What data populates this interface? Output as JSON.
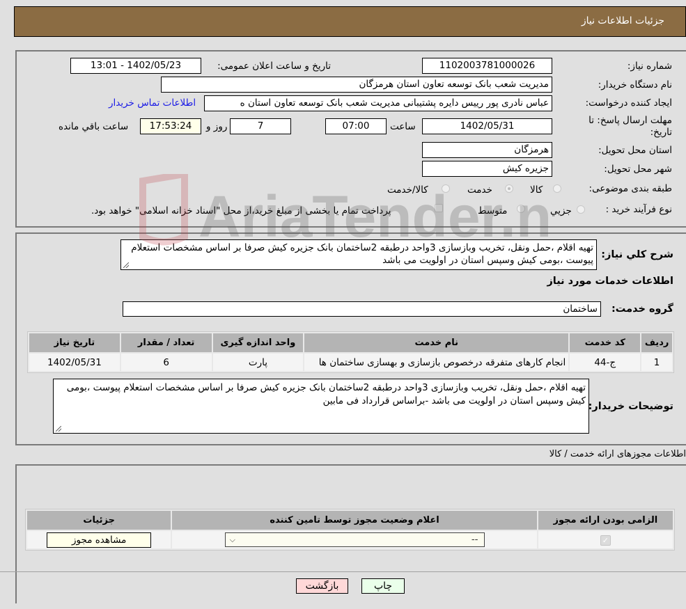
{
  "header": {
    "title": "جزئیات اطلاعات نیاز"
  },
  "details": {
    "need_number_label": "شماره نیاز:",
    "need_number": "1102003781000026",
    "announce_label": "تاریخ و ساعت اعلان عمومی:",
    "announce_value": "1402/05/23 - 13:01",
    "buyer_org_label": "نام دستگاه خریدار:",
    "buyer_org": "مدیریت شعب بانک توسعه تعاون استان هرمزگان",
    "creator_label": "ایجاد کننده درخواست:",
    "creator": "عباس نادری پور رییس دایره پشتیبانی مدیریت شعب بانک توسعه تعاون استان ه",
    "contact_link": "اطلاعات تماس خریدار",
    "deadline_label_1": "مهلت ارسال پاسخ: تا",
    "deadline_label_2": "تاریخ:",
    "deadline_date": "1402/05/31",
    "time_label": "ساعت",
    "deadline_time": "07:00",
    "days_value": "7",
    "days_label": "روز و",
    "remaining_time": "17:53:24",
    "remaining_label": "ساعت باقي مانده",
    "province_label": "استان محل تحویل:",
    "province": "هرمزگان",
    "city_label": "شهر محل تحویل:",
    "city": "جزیره کیش",
    "category_label": "طبقه بندی موضوعی:",
    "category_options": [
      "کالا",
      "خدمت",
      "کالا/خدمت"
    ],
    "category_selected": "خدمت",
    "process_label": "نوع فرآیند خرید :",
    "process_options": [
      "جزيي",
      "متوسط"
    ],
    "treasury_note": "پرداخت تمام یا بخشی از مبلغ خرید،از محل \"اسناد خزانه اسلامی\" خواهد بود."
  },
  "description": {
    "label": "شرح کلي نياز:",
    "text": "تهیه اقلام ،حمل ونقل، تخریب وبازسازی 3واحد درطبقه 2ساختمان بانک جزیره کیش صرفا بر اساس مشخصات استعلام پیوست ،بومی کیش وسپس استان در اولویت می باشد"
  },
  "services": {
    "section_title": "اطلاعات خدمات مورد نیاز",
    "group_label": "گروه خدمت:",
    "group_value": "ساختمان",
    "columns": [
      "ردیف",
      "کد خدمت",
      "نام خدمت",
      "واحد اندازه گیری",
      "تعداد / مقدار",
      "تاریخ نیاز"
    ],
    "rows": [
      {
        "row": "1",
        "code": "ج-44",
        "name": "انجام کارهای متفرقه درخصوص بازسازی و بهسازی ساختمان ها",
        "unit": "پارت",
        "qty": "6",
        "date": "1402/05/31"
      }
    ]
  },
  "buyer_notes": {
    "label": "توضیحات خریدار:",
    "text": "تهیه اقلام ،حمل ونقل، تخریب وبازسازی 3واحد درطبقه 2ساختمان بانک جزیره کیش صرفا بر اساس مشخصات استعلام پیوست ،بومی کیش وسپس استان در اولویت می باشد -براساس قرارداد فی مابین"
  },
  "licenses": {
    "section_title": "اطلاعات مجوزهای ارائه خدمت / کالا",
    "columns": [
      "الزامی بودن ارائه مجوز",
      "اعلام وضعیت مجوز توسط تامین کننده",
      "جزئیات"
    ],
    "status_select": "--",
    "required_checked": true,
    "view_button": "مشاهده مجوز"
  },
  "buttons": {
    "print": "چاپ",
    "back": "بازگشت"
  },
  "watermark": {
    "text": "AriaTender.net"
  }
}
